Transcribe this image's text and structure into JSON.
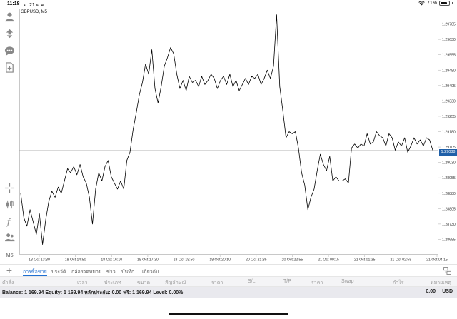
{
  "status_bar": {
    "time": "11:18",
    "date": "จ. 21 ต.ค.",
    "battery": "71%",
    "battery_level": 0.71
  },
  "chart": {
    "symbol_label": "GBPUSD, M5",
    "current_price": "1.29088",
    "bg_color": "#ffffff",
    "line_color": "#000000"
  },
  "chart_data": {
    "type": "line",
    "title": "GBPUSD, M5",
    "ylim": [
      1.2858,
      1.2978
    ],
    "x_ticks": [
      "18 Oct 13:30",
      "18 Oct 14:50",
      "18 Oct 16:10",
      "18 Oct 17:30",
      "18 Oct 18:50",
      "18 Oct 20:10",
      "20 Oct 21:35",
      "20 Oct 22:55",
      "21 Oct 00:15",
      "21 Oct 01:35",
      "21 Oct 02:55",
      "21 Oct 04:15"
    ],
    "y_ticks": [
      "1.29705",
      "1.29630",
      "1.29555",
      "1.29480",
      "1.29405",
      "1.29330",
      "1.29255",
      "1.29180",
      "1.29105",
      "1.29030",
      "1.28955",
      "1.28880",
      "1.28805",
      "1.28730",
      "1.28655"
    ],
    "current_price": 1.29088,
    "values": [
      1.2888,
      1.2876,
      1.2872,
      1.288,
      1.2874,
      1.2868,
      1.2878,
      1.2863,
      1.2875,
      1.2884,
      1.2889,
      1.2886,
      1.2891,
      1.2888,
      1.2894,
      1.29,
      1.2898,
      1.2901,
      1.2897,
      1.2902,
      1.2896,
      1.2893,
      1.2886,
      1.2873,
      1.289,
      1.2898,
      1.2894,
      1.2901,
      1.2904,
      1.2896,
      1.2893,
      1.289,
      1.2894,
      1.289,
      1.2904,
      1.2908,
      1.2919,
      1.2927,
      1.2936,
      1.2942,
      1.2951,
      1.2946,
      1.2958,
      1.2939,
      1.2932,
      1.294,
      1.295,
      1.2954,
      1.2959,
      1.2956,
      1.2946,
      1.2939,
      1.2943,
      1.2938,
      1.2945,
      1.2942,
      1.2943,
      1.294,
      1.2945,
      1.2941,
      1.2943,
      1.2946,
      1.2944,
      1.2939,
      1.2943,
      1.2945,
      1.2941,
      1.2946,
      1.294,
      1.2943,
      1.2938,
      1.2941,
      1.2944,
      1.2941,
      1.2945,
      1.2944,
      1.2946,
      1.2941,
      1.2944,
      1.2948,
      1.2944,
      1.295,
      1.2975,
      1.294,
      1.2928,
      1.2915,
      1.2918,
      1.2917,
      1.2918,
      1.291,
      1.2898,
      1.2892,
      1.288,
      1.2886,
      1.289,
      1.2899,
      1.2907,
      1.2902,
      1.2899,
      1.2906,
      1.2894,
      1.2896,
      1.2894,
      1.2894,
      1.2895,
      1.2893,
      1.291,
      1.2912,
      1.291,
      1.2912,
      1.2911,
      1.2917,
      1.2912,
      1.2913,
      1.2918,
      1.2916,
      1.2915,
      1.2911,
      1.2917,
      1.2915,
      1.2909,
      1.2913,
      1.2911,
      1.2915,
      1.2908,
      1.2911,
      1.2915,
      1.2912,
      1.2914,
      1.2911,
      1.2915,
      1.2914,
      1.2909
    ]
  },
  "sidebar": {
    "icons": [
      "user-icon",
      "trade-arrows-icon",
      "chat-icon",
      "add-document-icon",
      "crosshair-icon",
      "bar-type-icon",
      "function-icon",
      "users-icon"
    ],
    "timeframe": "M5"
  },
  "terminal": {
    "tabs": [
      "การซื้อขาย",
      "ประวัติ",
      "กล่องจดหมาย",
      "ข่าว",
      "บันทึก",
      "เกี่ยวกับ"
    ],
    "active_tab_index": 0,
    "columns": [
      "คำสั่ง",
      "เวลา",
      "ประเภท",
      "ขนาด",
      "สัญลักษณ์",
      "ราคา",
      "S/L",
      "T/P",
      "ราคา",
      "Swap",
      "กำไร",
      "หมายเหตุ"
    ],
    "balance_line": "Balance: 1 169.94 Equity: 1 169.94 หลักประกัน: 0.00 ฟรี: 1 169.94 Level: 0.00%",
    "total_profit": "0.00",
    "currency": "USD"
  }
}
